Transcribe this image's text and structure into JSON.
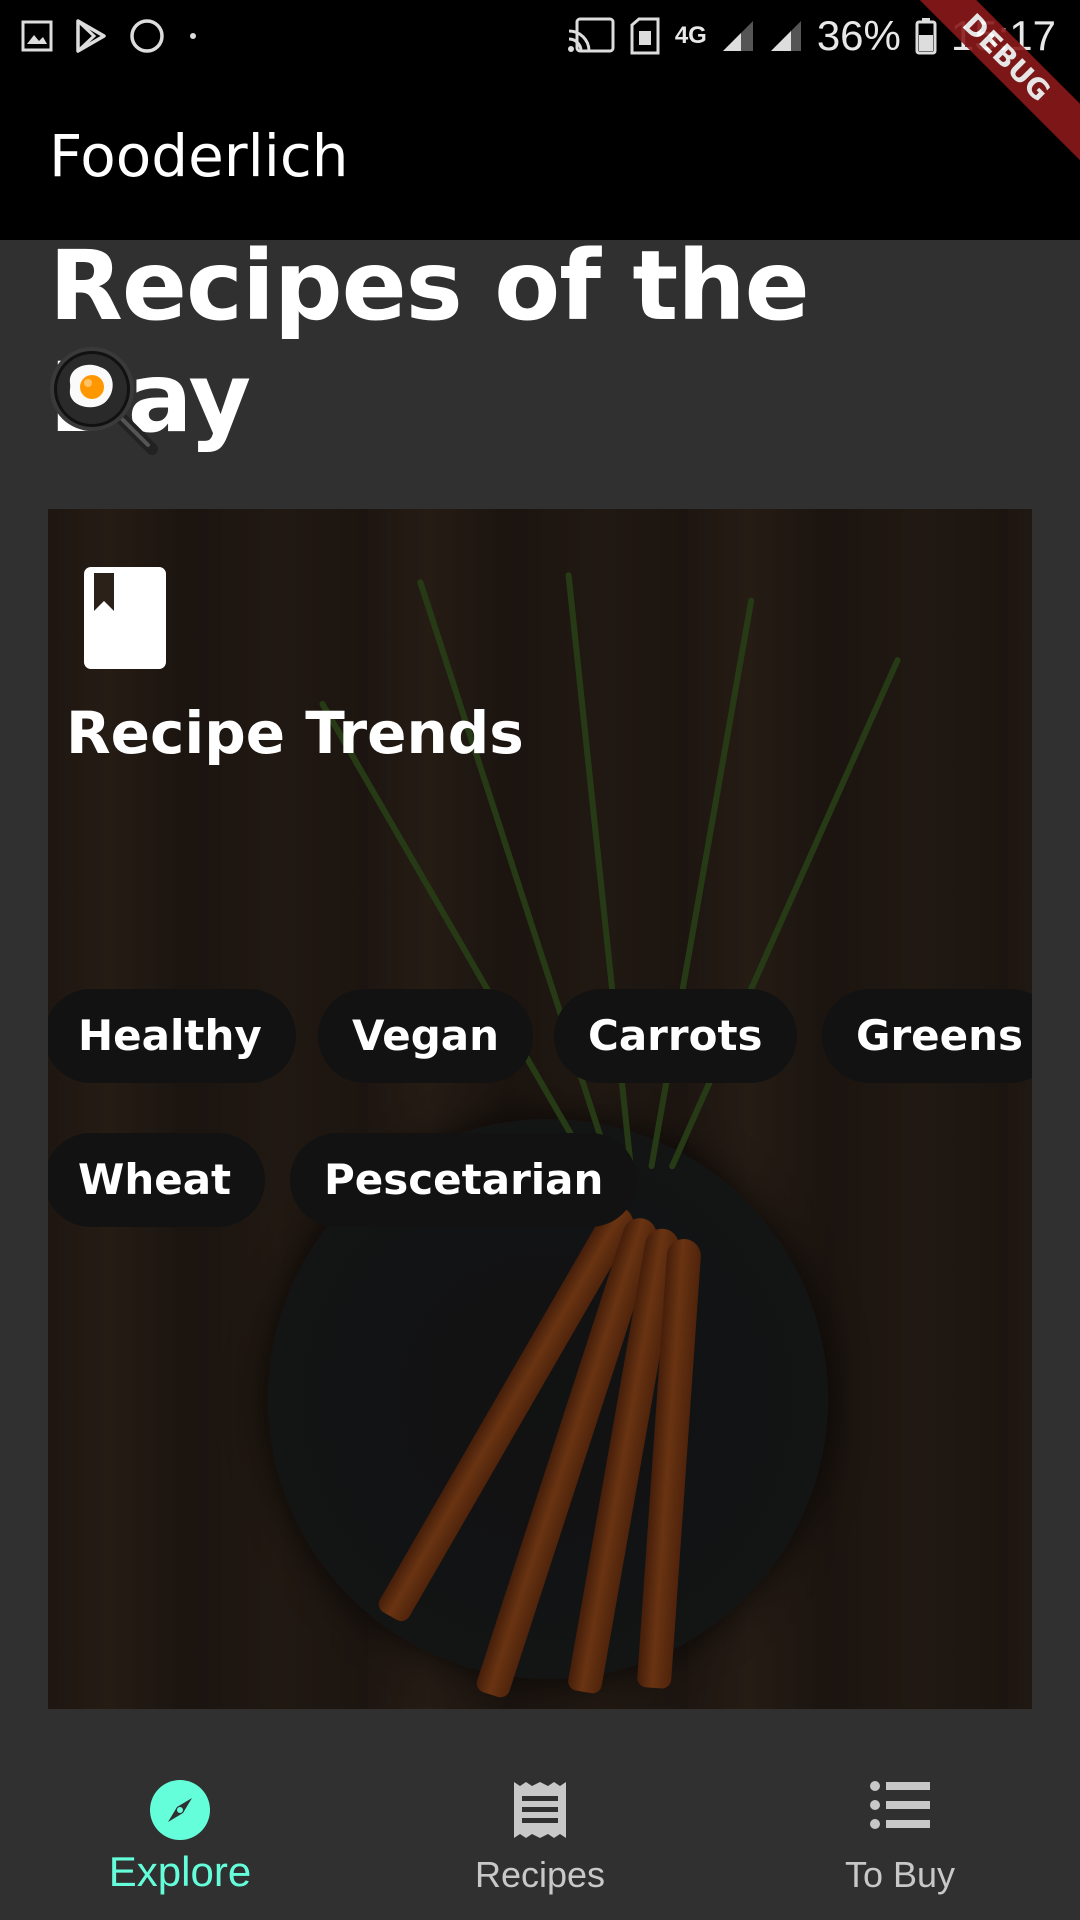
{
  "status_bar": {
    "battery_percent": "36%",
    "time": "15:17",
    "network_type": "4G",
    "left_icons": [
      "gallery-icon",
      "play-store-icon",
      "circle-icon",
      "dot-icon"
    ],
    "right_icons": [
      "cast-icon",
      "sim-icon",
      "signal-icon",
      "signal-icon",
      "battery-icon"
    ]
  },
  "debug_banner": "DEBUG",
  "app_bar": {
    "title": "Fooderlich"
  },
  "main": {
    "section_title": "Recipes of the Day",
    "section_icon": "cooking-egg-pan-icon",
    "card": {
      "icon": "book-icon",
      "title": "Recipe Trends",
      "chips": [
        "Healthy",
        "Vegan",
        "Carrots",
        "Greens",
        "Wheat",
        "Pescetarian"
      ]
    }
  },
  "bottom_nav": {
    "items": [
      {
        "label": "Explore",
        "icon": "compass-icon",
        "active": true
      },
      {
        "label": "Recipes",
        "icon": "receipt-icon",
        "active": false
      },
      {
        "label": "To Buy",
        "icon": "list-icon",
        "active": false
      }
    ],
    "active_color": "#64ffda",
    "inactive_color": "#c8c8c8"
  }
}
